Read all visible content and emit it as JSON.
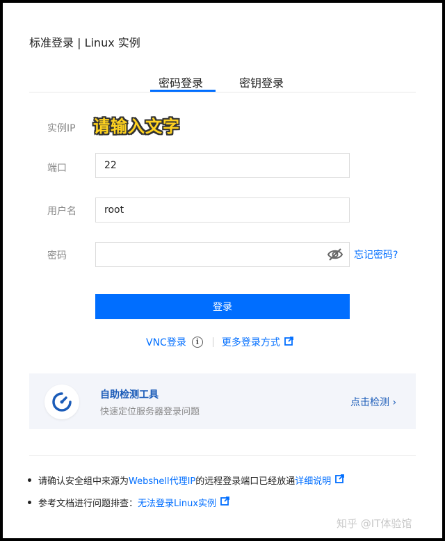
{
  "header": {
    "title": "标准登录 | Linux 实例"
  },
  "tabs": [
    {
      "label": "密码登录",
      "active": true
    },
    {
      "label": "密钥登录",
      "active": false
    }
  ],
  "form": {
    "instance_ip": {
      "label": "实例IP",
      "value": "请输入文字"
    },
    "port": {
      "label": "端口",
      "value": "22"
    },
    "username": {
      "label": "用户名",
      "value": "root"
    },
    "password": {
      "label": "密码",
      "value": ""
    },
    "forgot_label": "忘记密码?",
    "login_label": "登录"
  },
  "alt_links": {
    "vnc_label": "VNC登录",
    "more_label": "更多登录方式"
  },
  "diagnostics": {
    "title": "自助检测工具",
    "subtitle": "快速定位服务器登录问题",
    "action_label": "点击检测 ›"
  },
  "notes": {
    "note1_prefix": "请确认安全组中来源为",
    "note1_link1": "Webshell代理IP",
    "note1_mid": "的远程登录端口已经放通",
    "note1_link2": "详细说明",
    "note2_prefix": "参考文档进行问题排查：",
    "note2_link": "无法登录Linux实例"
  },
  "watermark": "知乎 @IT体验馆",
  "colors": {
    "accent": "#006eff",
    "link_dark": "#1a5bb8",
    "panel_bg": "#f3f5fa"
  }
}
